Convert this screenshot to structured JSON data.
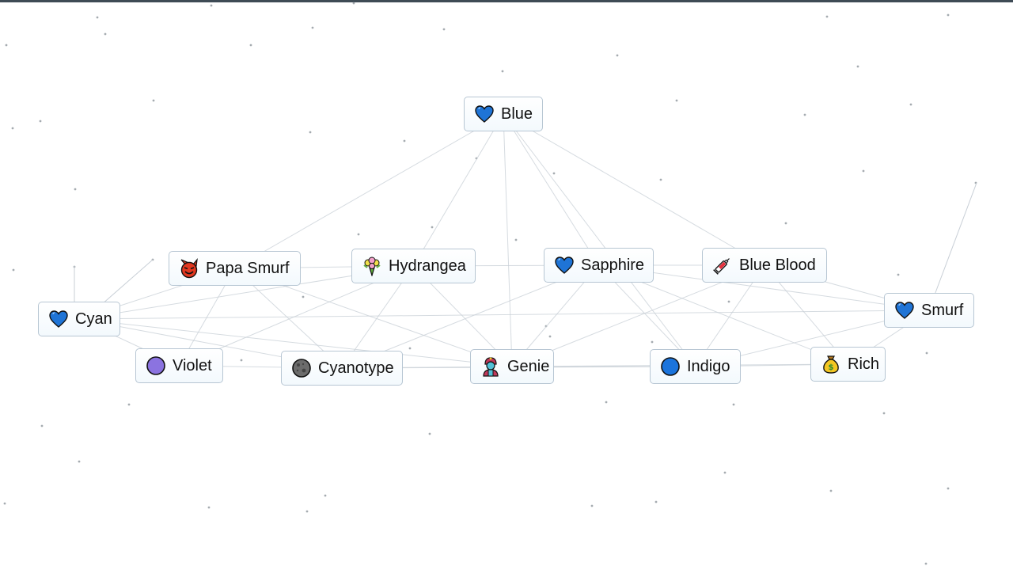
{
  "game": {
    "elements": [
      {
        "id": "blue",
        "label": "Blue",
        "icon": "blue-heart-icon",
        "emoji": "💙"
      },
      {
        "id": "papa-smurf",
        "label": "Papa Smurf",
        "icon": "smiling-devil-icon",
        "emoji": "😈"
      },
      {
        "id": "hydrangea",
        "label": "Hydrangea",
        "icon": "bouquet-icon",
        "emoji": "💐"
      },
      {
        "id": "sapphire",
        "label": "Sapphire",
        "icon": "blue-heart-icon",
        "emoji": "💙"
      },
      {
        "id": "blue-blood",
        "label": "Blue Blood",
        "icon": "syringe-icon",
        "emoji": "💉"
      },
      {
        "id": "smurf",
        "label": "Smurf",
        "icon": "blue-heart-icon",
        "emoji": "💙"
      },
      {
        "id": "cyan",
        "label": "Cyan",
        "icon": "blue-heart-icon",
        "emoji": "💙"
      },
      {
        "id": "violet",
        "label": "Violet",
        "icon": "purple-circle-icon",
        "emoji": "🟣"
      },
      {
        "id": "cyanotype",
        "label": "Cyanotype",
        "icon": "new-moon-icon",
        "emoji": "🌑"
      },
      {
        "id": "genie",
        "label": "Genie",
        "icon": "genie-icon",
        "emoji": "🧞"
      },
      {
        "id": "indigo",
        "label": "Indigo",
        "icon": "blue-circle-icon",
        "emoji": "🔵"
      },
      {
        "id": "rich",
        "label": "Rich",
        "icon": "money-bag-icon",
        "emoji": "💰"
      }
    ],
    "connections": [
      [
        "blue",
        "hydrangea"
      ],
      [
        "blue",
        "genie"
      ],
      [
        "blue",
        "sapphire"
      ],
      [
        "blue",
        "blue-blood"
      ],
      [
        "blue",
        "papa-smurf"
      ],
      [
        "blue",
        "indigo"
      ],
      [
        "papa-smurf",
        "hydrangea"
      ],
      [
        "papa-smurf",
        "cyan"
      ],
      [
        "papa-smurf",
        "violet"
      ],
      [
        "papa-smurf",
        "cyanotype"
      ],
      [
        "papa-smurf",
        "genie"
      ],
      [
        "hydrangea",
        "sapphire"
      ],
      [
        "hydrangea",
        "cyanotype"
      ],
      [
        "hydrangea",
        "genie"
      ],
      [
        "hydrangea",
        "cyan"
      ],
      [
        "hydrangea",
        "violet"
      ],
      [
        "sapphire",
        "blue-blood"
      ],
      [
        "sapphire",
        "genie"
      ],
      [
        "sapphire",
        "indigo"
      ],
      [
        "sapphire",
        "cyanotype"
      ],
      [
        "sapphire",
        "smurf"
      ],
      [
        "sapphire",
        "rich"
      ],
      [
        "blue-blood",
        "smurf"
      ],
      [
        "blue-blood",
        "indigo"
      ],
      [
        "blue-blood",
        "rich"
      ],
      [
        "blue-blood",
        "genie"
      ],
      [
        "smurf",
        "rich"
      ],
      [
        "smurf",
        "indigo"
      ],
      [
        "smurf",
        "cyan"
      ],
      [
        "cyan",
        "violet"
      ],
      [
        "cyan",
        "cyanotype"
      ],
      [
        "cyan",
        "genie"
      ],
      [
        "violet",
        "cyanotype"
      ],
      [
        "cyanotype",
        "genie"
      ],
      [
        "cyanotype",
        "indigo"
      ],
      [
        "genie",
        "indigo"
      ],
      [
        "indigo",
        "rich"
      ],
      [
        "genie",
        "rich"
      ]
    ],
    "colors": {
      "background": "#ffffff",
      "node_border": "#b7c6d3",
      "edge": "#c8cfd6",
      "particle": "#8f969c",
      "top_bar": "#3e4b55"
    }
  }
}
